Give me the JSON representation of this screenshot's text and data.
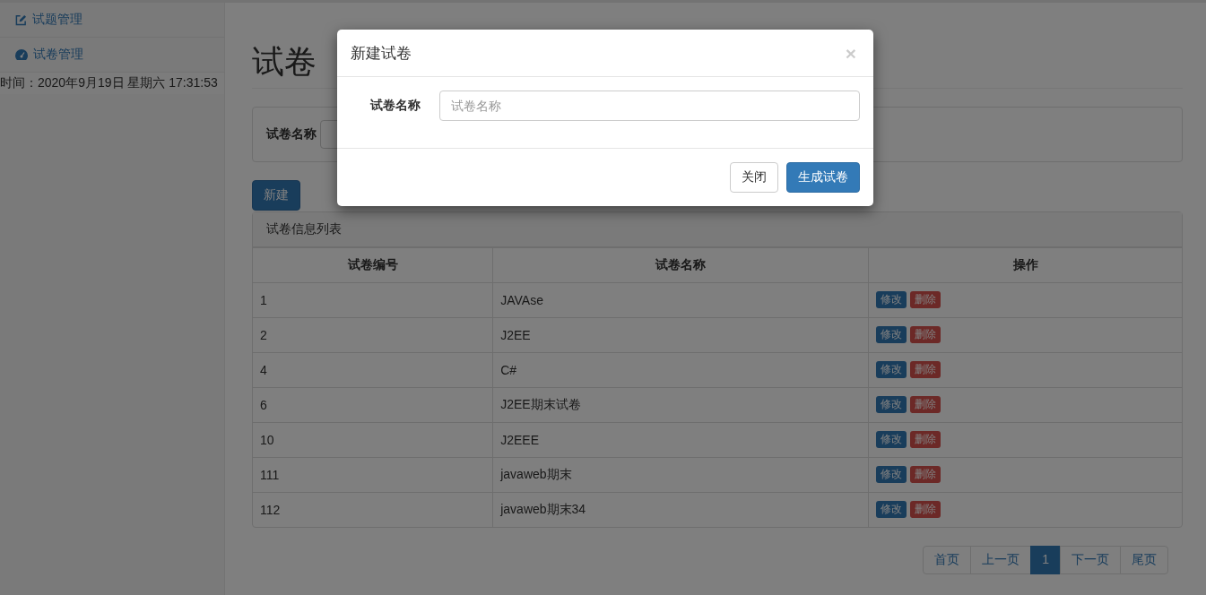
{
  "sidebar": {
    "items": [
      {
        "label": "试题管理"
      },
      {
        "label": "试卷管理"
      }
    ],
    "clock": "时间：2020年9月19日 星期六 17:31:53"
  },
  "page": {
    "title": "试卷",
    "search": {
      "label": "试卷名称"
    },
    "new_button": "新建"
  },
  "table": {
    "caption": "试卷信息列表",
    "columns": [
      "试卷编号",
      "试卷名称",
      "操作"
    ],
    "rows": [
      {
        "id": "1",
        "name": "JAVAse",
        "actions": [
          "修改",
          "删除"
        ]
      },
      {
        "id": "2",
        "name": "J2EE",
        "actions": [
          "修改",
          "删除"
        ]
      },
      {
        "id": "4",
        "name": "C#",
        "actions": [
          "修改",
          "删除"
        ]
      },
      {
        "id": "6",
        "name": "J2EE期末试卷",
        "actions": [
          "修改",
          "删除"
        ]
      },
      {
        "id": "10",
        "name": "J2EEE",
        "actions": [
          "修改",
          "删除"
        ]
      },
      {
        "id": "111",
        "name": "javaweb期末",
        "actions": [
          "修改",
          "删除"
        ]
      },
      {
        "id": "112",
        "name": "javaweb期末34",
        "actions": [
          "修改",
          "删除"
        ]
      }
    ]
  },
  "pagination": [
    {
      "label": "首页",
      "selected": false
    },
    {
      "label": "上一页",
      "selected": false
    },
    {
      "label": "1",
      "selected": true
    },
    {
      "label": "下一页",
      "selected": false
    },
    {
      "label": "尾页",
      "selected": false
    }
  ],
  "dialog": {
    "title": "新建试卷",
    "close": "×",
    "field_label": "试卷名称",
    "placeholder": "试卷名称",
    "buttons": [
      {
        "label": "关闭",
        "kind": "default"
      },
      {
        "label": "生成试卷",
        "kind": "primary"
      }
    ]
  }
}
